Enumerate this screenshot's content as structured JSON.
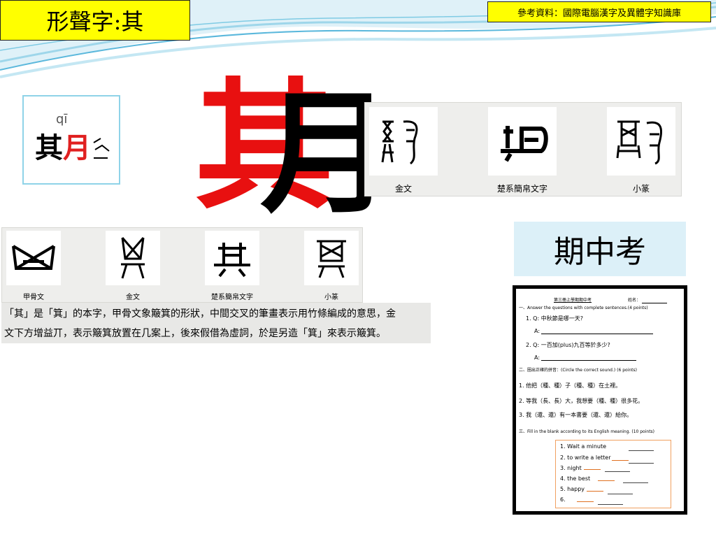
{
  "header": {
    "title": "形聲字:其",
    "reference": "參考資料：國際電腦漢字及異體字知識庫"
  },
  "pinyin_card": {
    "pinyin": "qī",
    "char_left": "其",
    "char_right": "月"
  },
  "main_character": {
    "phonetic": "其",
    "radical": "月"
  },
  "period_panel_top": {
    "labels": [
      "金文",
      "楚系簡帛文字",
      "小篆"
    ]
  },
  "period_panel_left": {
    "labels": [
      "甲骨文",
      "金文",
      "楚系簡帛文字",
      "小篆"
    ]
  },
  "description": {
    "line1": "「其」是「箕」的本字，甲骨文象簸箕的形狀，中間交叉的筆畫表示用竹條編成的意思，金",
    "line2": "文下方增益丌，表示簸箕放置在几案上，後來假借為虛詞，於是另造「箕」來表示簸箕。"
  },
  "midterm": {
    "label": "期中考"
  },
  "worksheet": {
    "title": "第三冊上學期期中考",
    "name_label": "姓名：",
    "section1": "一、Answer the questions with complete sentences.(4 points)",
    "q1": "1. Q: 中秋節是哪一天?",
    "a1": "A:",
    "q2": "2. Q: 一百加(plus)九百等於多少?",
    "a2": "A:",
    "section2": "二、圈出正確的拼音：(Circle the correct sound.) (6 points)",
    "s2q1": "1. 他把（種、種）子（種、種）在土裡。",
    "s2q2": "2. 等我（長、長）大，我想要（種、種）很多花。",
    "s2q3": "3. 我（還、還）有一本書要（還、還）給你。",
    "section3": "三、Fill in the blank according to its English meaning. (10 points)",
    "fill_items": [
      "1. Wait a minute",
      "2. to write a letter",
      "3. night",
      "4. the best",
      "5. happy",
      "6."
    ]
  }
}
